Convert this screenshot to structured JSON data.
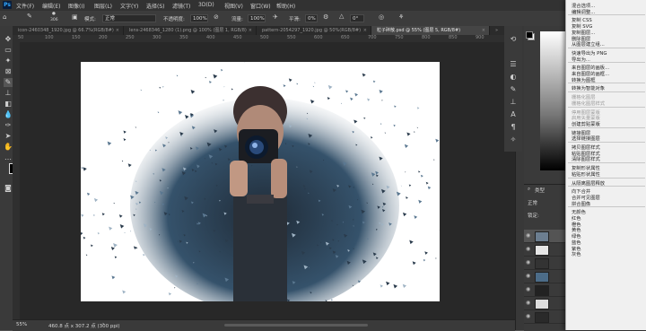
{
  "menubar": {
    "app_icon": "Ps",
    "items": [
      "文件(F)",
      "编辑(E)",
      "图像(I)",
      "图层(L)",
      "文字(Y)",
      "选择(S)",
      "滤镜(T)",
      "3D(D)",
      "视图(V)",
      "窗口(W)",
      "帮助(H)"
    ]
  },
  "options": {
    "brush_size": "306",
    "mode_label": "模式:",
    "mode_value": "正常",
    "opacity_label": "不透明度:",
    "opacity_value": "100%",
    "flow_label": "流量:",
    "flow_value": "100%",
    "smooth_label": "平滑:",
    "smooth_value": "0%",
    "angle_value": "0°"
  },
  "tabs": [
    {
      "label": "icon-2460348_1920.jpg @ 66.7%(RGB/8#)",
      "active": false
    },
    {
      "label": "lens-2468346_1280 (1).png @ 100% (图层 1, RGB/8)",
      "active": false
    },
    {
      "label": "pattern-2054297_1920.jpg @ 50%(RGB/8#)",
      "active": false
    },
    {
      "label": "粒子碎散.psd @ 55% (图层 5, RGB/8#)",
      "active": true
    }
  ],
  "ruler_top": [
    "50",
    "100",
    "150",
    "200",
    "250",
    "300",
    "350",
    "400",
    "450",
    "500",
    "550",
    "600",
    "650",
    "700",
    "750",
    "800",
    "850",
    "900"
  ],
  "status": {
    "zoom": "55%",
    "doc_size": "460.8 点 x 307.2 点 (300 ppi)"
  },
  "layers": {
    "filter_label": "类型",
    "blend_mode": "正常",
    "lock_label": "锁定:",
    "rows": [
      "",
      "",
      "",
      "",
      "",
      "",
      ""
    ]
  },
  "context_menu": {
    "items": [
      {
        "label": "混合选项...",
        "disabled": false
      },
      {
        "label": "编辑调整...",
        "disabled": false
      },
      {
        "sep": true
      },
      {
        "label": "复制 CSS",
        "disabled": false
      },
      {
        "label": "复制 SVG",
        "disabled": false
      },
      {
        "label": "复制图层...",
        "disabled": false
      },
      {
        "label": "删除图层",
        "disabled": false
      },
      {
        "label": "从图层建立组...",
        "disabled": false
      },
      {
        "sep": true
      },
      {
        "label": "快速导出为 PNG",
        "disabled": false
      },
      {
        "label": "导出为...",
        "disabled": false
      },
      {
        "sep": true
      },
      {
        "label": "来自图层的画板...",
        "disabled": false
      },
      {
        "label": "来自图层的画框...",
        "disabled": false
      },
      {
        "label": "转换为图框",
        "disabled": false
      },
      {
        "sep": true
      },
      {
        "label": "转换为智能对象",
        "disabled": false
      },
      {
        "sep": true
      },
      {
        "label": "栅格化图层",
        "disabled": true
      },
      {
        "label": "栅格化图层样式",
        "disabled": true
      },
      {
        "sep": true
      },
      {
        "label": "停用图层蒙版",
        "disabled": true
      },
      {
        "label": "启用矢量蒙版",
        "disabled": true
      },
      {
        "label": "创建剪贴蒙版",
        "disabled": false
      },
      {
        "sep": true
      },
      {
        "label": "链接图层",
        "disabled": false
      },
      {
        "label": "选择链接图层",
        "disabled": false
      },
      {
        "sep": true
      },
      {
        "label": "拷贝图层样式",
        "disabled": false
      },
      {
        "label": "粘贴图层样式",
        "disabled": false
      },
      {
        "label": "清除图层样式",
        "disabled": false
      },
      {
        "sep": true
      },
      {
        "label": "复制形状属性",
        "disabled": false
      },
      {
        "label": "粘贴形状属性",
        "disabled": false
      },
      {
        "sep": true
      },
      {
        "label": "从隔离图层释放",
        "disabled": false
      },
      {
        "sep": true
      },
      {
        "label": "向下合并",
        "disabled": false
      },
      {
        "label": "合并可见图层",
        "disabled": false
      },
      {
        "label": "拼合图像",
        "disabled": false
      },
      {
        "sep": true
      },
      {
        "label": "无颜色",
        "disabled": false
      },
      {
        "label": "红色",
        "disabled": false
      },
      {
        "label": "橙色",
        "disabled": false
      },
      {
        "label": "黄色",
        "disabled": false
      },
      {
        "label": "绿色",
        "disabled": false
      },
      {
        "label": "蓝色",
        "disabled": false
      },
      {
        "label": "紫色",
        "disabled": false
      },
      {
        "label": "灰色",
        "disabled": false
      }
    ]
  },
  "colors": {
    "app_bg": "#535353",
    "panel_bg": "#3a3a3a",
    "menu_bg": "#f0f0f0",
    "accent": "#31a8ff"
  }
}
